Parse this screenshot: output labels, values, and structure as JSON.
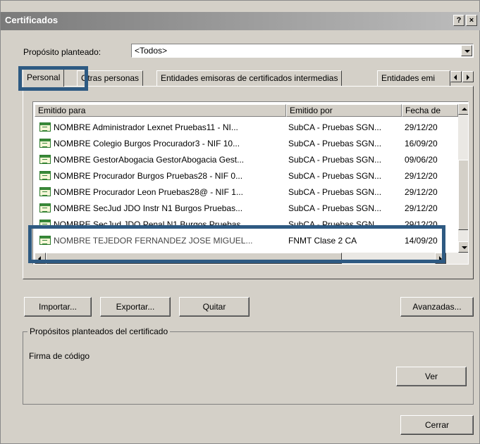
{
  "window": {
    "title": "Certificados",
    "help_button": "?",
    "close_button": "×"
  },
  "purpose": {
    "label": "Propósito planteado:",
    "selected": "<Todos>"
  },
  "tabs": [
    {
      "label": "Personal"
    },
    {
      "label": "Otras personas"
    },
    {
      "label": "Entidades emisoras de certificados intermedias"
    },
    {
      "label": "Entidades emi"
    }
  ],
  "list": {
    "columns": [
      "Emitido para",
      "Emitido por",
      "Fecha de"
    ],
    "rows": [
      {
        "issued_to": "NOMBRE Administrador Lexnet Pruebas11 - NI...",
        "issued_by": "SubCA - Pruebas SGN...",
        "date": "29/12/20"
      },
      {
        "issued_to": "NOMBRE Colegio Burgos Procurador3 - NIF 10...",
        "issued_by": "SubCA - Pruebas SGN...",
        "date": "16/09/20"
      },
      {
        "issued_to": "NOMBRE GestorAbogacia GestorAbogacia Gest...",
        "issued_by": "SubCA - Pruebas SGN...",
        "date": "09/06/20"
      },
      {
        "issued_to": "NOMBRE Procurador Burgos Pruebas28 - NIF 0...",
        "issued_by": "SubCA - Pruebas SGN...",
        "date": "29/12/20"
      },
      {
        "issued_to": "NOMBRE Procurador Leon Pruebas28@ - NIF 1...",
        "issued_by": "SubCA - Pruebas SGN...",
        "date": "29/12/20"
      },
      {
        "issued_to": "NOMBRE SecJud JDO Instr N1 Burgos Pruebas...",
        "issued_by": "SubCA - Pruebas SGN...",
        "date": "29/12/20"
      },
      {
        "issued_to": "NOMBRE SecJud JDO Penal N1 Burgos Pruebas...",
        "issued_by": "SubCA - Pruebas SGN...",
        "date": "29/12/20"
      },
      {
        "issued_to": "NOMBRE TEJEDOR FERNANDEZ JOSE MIGUEL...",
        "issued_by": "FNMT Clase 2 CA",
        "date": "14/09/20"
      }
    ]
  },
  "buttons": {
    "import": "Importar...",
    "export": "Exportar...",
    "remove": "Quitar",
    "advanced": "Avanzadas...",
    "view": "Ver",
    "close": "Cerrar"
  },
  "cert_purposes": {
    "legend": "Propósitos planteados del certificado",
    "value": "Firma de código"
  },
  "highlight_color": "#2e5a82"
}
